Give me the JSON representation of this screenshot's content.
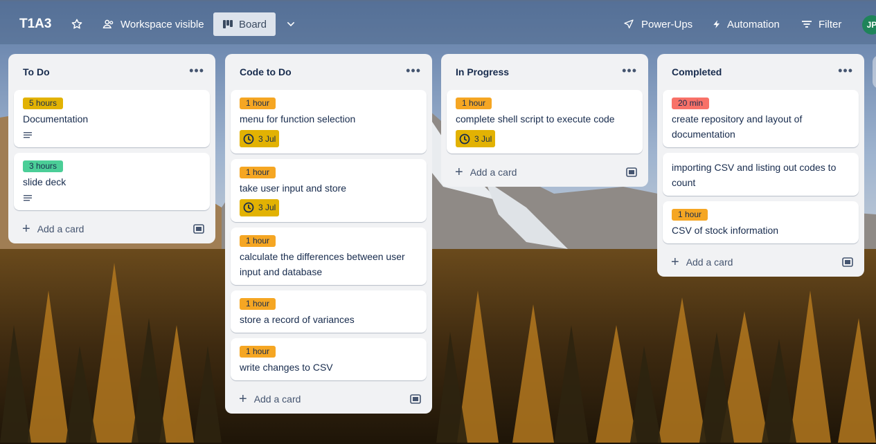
{
  "header": {
    "board_title": "T1A3",
    "workspace": "Workspace visible",
    "board_view": "Board",
    "power_ups": "Power-Ups",
    "automation": "Automation",
    "filter": "Filter",
    "avatar_initials": "JP"
  },
  "icons": [
    "star-icon",
    "people-icon",
    "board-icon",
    "chevron-down-icon",
    "rocket-icon",
    "lightning-icon",
    "filter-icon",
    "dots-icon",
    "description-icon",
    "clock-icon",
    "plus-icon",
    "template-icon"
  ],
  "colors": {
    "yellow_label": "#e2b203",
    "green_label": "#4bce97",
    "orange_label": "#f5a623",
    "red_label": "#f87168",
    "due_badge": "#e2b203"
  },
  "lists": [
    {
      "title": "To Do",
      "add_label": "Add a card",
      "cards": [
        {
          "label": "5 hours",
          "text": "Documentation"
        },
        {
          "label": "3 hours",
          "text": "slide deck"
        }
      ]
    },
    {
      "title": "Code to Do",
      "add_label": "Add a card",
      "cards": [
        {
          "label": "1 hour",
          "text": "menu for function selection",
          "due": "3 Jul"
        },
        {
          "label": "1 hour",
          "text": "take user input and store",
          "due": "3 Jul"
        },
        {
          "label": "1 hour",
          "text": "calculate the differences between user input and database"
        },
        {
          "label": "1 hour",
          "text": "store a record of variances"
        },
        {
          "label": "1 hour",
          "text": "write changes to CSV"
        }
      ]
    },
    {
      "title": "In Progress",
      "add_label": "Add a card",
      "cards": [
        {
          "label": "1 hour",
          "text": "complete shell script to execute code",
          "due": "3 Jul"
        }
      ]
    },
    {
      "title": "Completed",
      "add_label": "Add a card",
      "cards": [
        {
          "label": "20 min",
          "text": "create repository and layout of documentation"
        },
        {
          "text": "importing CSV and listing out codes to count"
        },
        {
          "label": "1 hour",
          "text": "CSV of stock information"
        }
      ]
    }
  ]
}
